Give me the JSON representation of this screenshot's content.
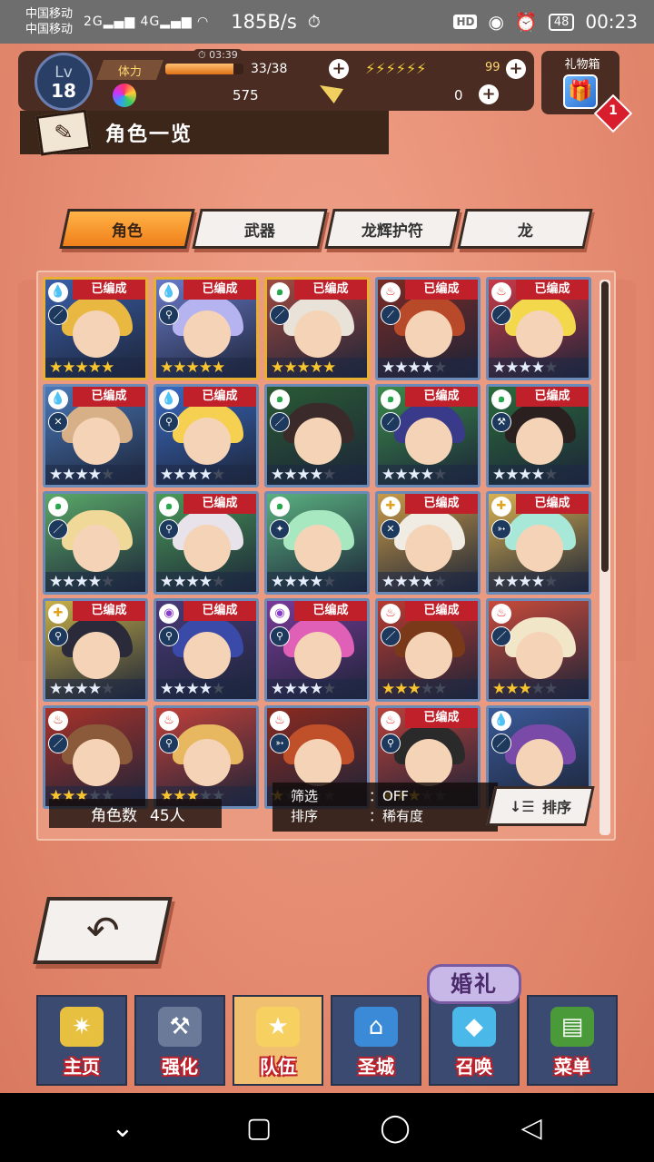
{
  "status_bar": {
    "carrier1": "中国移动",
    "carrier2": "中国移动",
    "sig1": "2G",
    "sig2": "4G",
    "speed": "185B/s",
    "hd": "HD",
    "battery": "48",
    "time": "00:23"
  },
  "player": {
    "lv_label": "Lv",
    "level": "18",
    "stamina_label": "体力",
    "stamina_value": "33/38",
    "stamina_fraction": 0.868,
    "stamina_timer": "03:39",
    "bolts": "⚡⚡⚡⚡⚡⚡",
    "bolt_value": "99",
    "gems": "575",
    "tickets": "0"
  },
  "gift": {
    "label": "礼物箱",
    "count": "1"
  },
  "page_title": "角色一览",
  "tabs": [
    {
      "label": "角色",
      "active": true
    },
    {
      "label": "武器",
      "active": false
    },
    {
      "label": "龙辉护符",
      "active": false
    },
    {
      "label": "龙",
      "active": false
    }
  ],
  "characters": [
    {
      "element": "water",
      "weapon": "sword",
      "badge": "已编成",
      "stars_on": 5,
      "stars_total": 5,
      "gold": true,
      "bg": "#3a5fa8",
      "hair": "#e8b840"
    },
    {
      "element": "water",
      "weapon": "staff",
      "badge": "已编成",
      "stars_on": 5,
      "stars_total": 5,
      "gold": true,
      "bg": "#6a7ac8",
      "hair": "#b6b4f0"
    },
    {
      "element": "wind",
      "weapon": "sword",
      "badge": "已编成",
      "stars_on": 5,
      "stars_total": 5,
      "gold": true,
      "bg": "#a04a40",
      "hair": "#e8e2d8"
    },
    {
      "element": "fire",
      "weapon": "blade",
      "badge": "已编成",
      "stars_on": 4,
      "stars_total": 5,
      "gold": false,
      "bg": "#7a2a24",
      "hair": "#b84a2a"
    },
    {
      "element": "fire",
      "weapon": "sword",
      "badge": "已编成",
      "stars_on": 4,
      "stars_total": 5,
      "gold": false,
      "bg": "#c83a48",
      "hair": "#f2d84a"
    },
    {
      "element": "water",
      "weapon": "dagger",
      "badge": "已编成",
      "stars_on": 4,
      "stars_total": 5,
      "gold": false,
      "bg": "#4a78b8",
      "hair": "#d8b088"
    },
    {
      "element": "water",
      "weapon": "staff",
      "badge": "已编成",
      "stars_on": 4,
      "stars_total": 5,
      "gold": false,
      "bg": "#3a6ac0",
      "hair": "#f6d050"
    },
    {
      "element": "wind",
      "weapon": "sword",
      "badge": "",
      "stars_on": 4,
      "stars_total": 5,
      "gold": false,
      "bg": "#2a5a34",
      "hair": "#3a2a2a"
    },
    {
      "element": "wind",
      "weapon": "blade",
      "badge": "已编成",
      "stars_on": 4,
      "stars_total": 5,
      "gold": false,
      "bg": "#3a8a4a",
      "hair": "#3a3a8a"
    },
    {
      "element": "wind",
      "weapon": "axe",
      "badge": "已编成",
      "stars_on": 4,
      "stars_total": 5,
      "gold": false,
      "bg": "#2a6a3a",
      "hair": "#2a2020"
    },
    {
      "element": "wind",
      "weapon": "sword",
      "badge": "",
      "stars_on": 4,
      "stars_total": 5,
      "gold": false,
      "bg": "#5aa868",
      "hair": "#f0d898"
    },
    {
      "element": "wind",
      "weapon": "staff",
      "badge": "已编成",
      "stars_on": 4,
      "stars_total": 5,
      "gold": false,
      "bg": "#4a9a58",
      "hair": "#e8e2ea"
    },
    {
      "element": "wind",
      "weapon": "wand",
      "badge": "",
      "stars_on": 4,
      "stars_total": 5,
      "gold": false,
      "bg": "#5ab080",
      "hair": "#a8e8c0"
    },
    {
      "element": "light",
      "weapon": "dagger",
      "badge": "已编成",
      "stars_on": 4,
      "stars_total": 5,
      "gold": false,
      "bg": "#c89a48",
      "hair": "#f0ece4"
    },
    {
      "element": "light",
      "weapon": "bow",
      "badge": "已编成",
      "stars_on": 4,
      "stars_total": 5,
      "gold": false,
      "bg": "#d8b050",
      "hair": "#a8e8d8"
    },
    {
      "element": "light",
      "weapon": "staff",
      "badge": "已编成",
      "stars_on": 4,
      "stars_total": 5,
      "gold": false,
      "bg": "#c8b048",
      "hair": "#2a2a3a"
    },
    {
      "element": "shadow",
      "weapon": "staff",
      "badge": "已编成",
      "stars_on": 4,
      "stars_total": 5,
      "gold": false,
      "bg": "#4a3a78",
      "hair": "#3a4aa8"
    },
    {
      "element": "shadow",
      "weapon": "staff",
      "badge": "已编成",
      "stars_on": 4,
      "stars_total": 5,
      "gold": false,
      "bg": "#7a3a98",
      "hair": "#e060b8"
    },
    {
      "element": "fire",
      "weapon": "sword",
      "badge": "已编成",
      "stars_on": 3,
      "stars_total": 5,
      "gold": false,
      "bg": "#b83a30",
      "hair": "#7a3a1a"
    },
    {
      "element": "fire",
      "weapon": "sword",
      "badge": "",
      "stars_on": 3,
      "stars_total": 5,
      "gold": false,
      "bg": "#c84a3a",
      "hair": "#f2e6c8"
    },
    {
      "element": "fire",
      "weapon": "sword",
      "badge": "",
      "stars_on": 3,
      "stars_total": 5,
      "gold": false,
      "bg": "#a8322a",
      "hair": "#8a5a3a"
    },
    {
      "element": "fire",
      "weapon": "staff",
      "badge": "",
      "stars_on": 3,
      "stars_total": 5,
      "gold": false,
      "bg": "#c0403a",
      "hair": "#e8b860"
    },
    {
      "element": "fire",
      "weapon": "bow",
      "badge": "",
      "stars_on": 1,
      "stars_total": 5,
      "gold": false,
      "bg": "#8a2a20",
      "hair": "#c0502a"
    },
    {
      "element": "fire",
      "weapon": "staff",
      "badge": "已编成",
      "stars_on": 3,
      "stars_total": 5,
      "gold": false,
      "bg": "#b8403a",
      "hair": "#2a2a2a"
    },
    {
      "element": "water",
      "weapon": "sword",
      "badge": "",
      "stars_on": 3,
      "stars_total": 5,
      "gold": false,
      "bg": "#3a5a98",
      "hair": "#7a4aa8"
    }
  ],
  "element_glyphs": {
    "water": "💧",
    "wind": "๑",
    "fire": "♨",
    "light": "✚",
    "shadow": "◉"
  },
  "weapon_glyphs": {
    "sword": "／",
    "staff": "⚲",
    "blade": "⟋",
    "dagger": "✕",
    "axe": "⚒",
    "wand": "✦",
    "bow": "➳"
  },
  "count": {
    "label": "角色数",
    "value": "45人"
  },
  "filter": {
    "filter_label": "筛选",
    "filter_value": "：OFF",
    "sort_label": "排序",
    "sort_value": "：稀有度"
  },
  "sort_button": "排序",
  "wedding": "婚礼",
  "nav": [
    {
      "label": "主页",
      "icon": "home-icon",
      "glyph": "✷",
      "color": "#e8c040"
    },
    {
      "label": "强化",
      "icon": "hammer-icon",
      "glyph": "⚒",
      "color": "#6a7a98"
    },
    {
      "label": "队伍",
      "icon": "team-icon",
      "glyph": "★",
      "color": "#f6d060"
    },
    {
      "label": "圣城",
      "icon": "castle-icon",
      "glyph": "⌂",
      "color": "#3a8ad8"
    },
    {
      "label": "召唤",
      "icon": "summon-icon",
      "glyph": "◆",
      "color": "#4ab8e8"
    },
    {
      "label": "菜单",
      "icon": "menu-book-icon",
      "glyph": "▤",
      "color": "#4a9a3a"
    }
  ]
}
